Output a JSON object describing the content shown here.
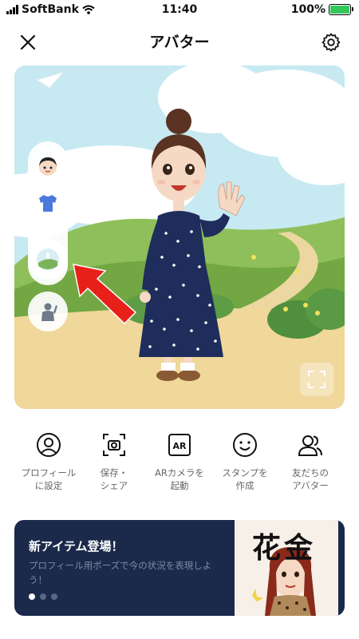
{
  "status_bar": {
    "carrier": "SoftBank",
    "time": "11:40",
    "battery": "100%"
  },
  "header": {
    "title": "アバター",
    "close_icon": "close-icon",
    "settings_icon": "gear-icon"
  },
  "scene": {
    "tools": [
      "face-icon",
      "shirt-icon",
      "background-icon",
      "pose-icon"
    ],
    "expand_icon": "fullscreen-icon"
  },
  "actions": [
    {
      "icon": "profile-icon",
      "label": "プロフィール\nに設定"
    },
    {
      "icon": "camera-icon",
      "label": "保存・\nシェア"
    },
    {
      "icon": "ar-icon",
      "label": "ARカメラを\n起動",
      "icon_text": "AR"
    },
    {
      "icon": "smile-icon",
      "label": "スタンプを\n作成"
    },
    {
      "icon": "friends-icon",
      "label": "友だちの\nアバター"
    }
  ],
  "banner": {
    "title": "新アイテム登場！",
    "description": "プロフィール用ポーズで今の状況を表現しよう！",
    "art_text": "花金",
    "page_count": 3,
    "active_page": 1
  },
  "colors": {
    "accent": "#35c759",
    "banner_bg": "#1b2a4a",
    "arrow": "#e8201a"
  }
}
